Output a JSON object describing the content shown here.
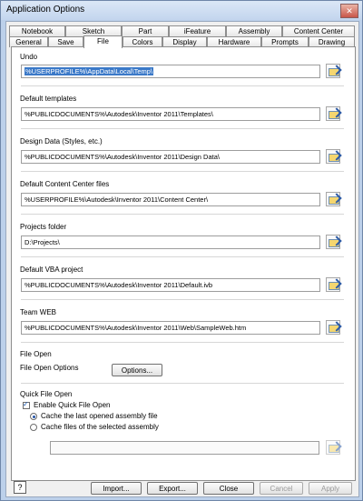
{
  "title": "Application Options",
  "tabs": {
    "row1": [
      "Notebook",
      "Sketch",
      "Part",
      "iFeature",
      "Assembly",
      "Content Center"
    ],
    "row2": [
      "General",
      "Save",
      "File",
      "Colors",
      "Display",
      "Hardware",
      "Prompts",
      "Drawing"
    ],
    "active": "File"
  },
  "groups": {
    "undo": {
      "label": "Undo",
      "value": "%USERPROFILE%\\AppData\\Local\\Temp\\"
    },
    "default_templates": {
      "label": "Default templates",
      "value": "%PUBLICDOCUMENTS%\\Autodesk\\Inventor 2011\\Templates\\"
    },
    "design_data": {
      "label": "Design Data (Styles, etc.)",
      "value": "%PUBLICDOCUMENTS%\\Autodesk\\Inventor 2011\\Design Data\\"
    },
    "content_center": {
      "label": "Default Content Center files",
      "value": "%USERPROFILE%\\Autodesk\\Inventor 2011\\Content Center\\"
    },
    "projects": {
      "label": "Projects folder",
      "value": "D:\\Projects\\"
    },
    "vba": {
      "label": "Default VBA project",
      "value": "%PUBLICDOCUMENTS%\\Autodesk\\Inventor 2011\\Default.ivb"
    },
    "team_web": {
      "label": "Team WEB",
      "value": "%PUBLICDOCUMENTS%\\Autodesk\\Inventor 2011\\Web\\SampleWeb.htm"
    }
  },
  "file_open": {
    "heading": "File Open",
    "options_label": "File Open Options",
    "button": "Options..."
  },
  "quick_open": {
    "heading": "Quick File Open",
    "enable": "Enable Quick File Open",
    "opt1": "Cache the last opened assembly file",
    "opt2": "Cache files of the selected assembly"
  },
  "buttons": {
    "import": "Import...",
    "export": "Export...",
    "close": "Close",
    "cancel": "Cancel",
    "apply": "Apply"
  },
  "icons": {
    "browse": "folder-browse-icon",
    "help": "help-icon",
    "close": "close-icon"
  }
}
